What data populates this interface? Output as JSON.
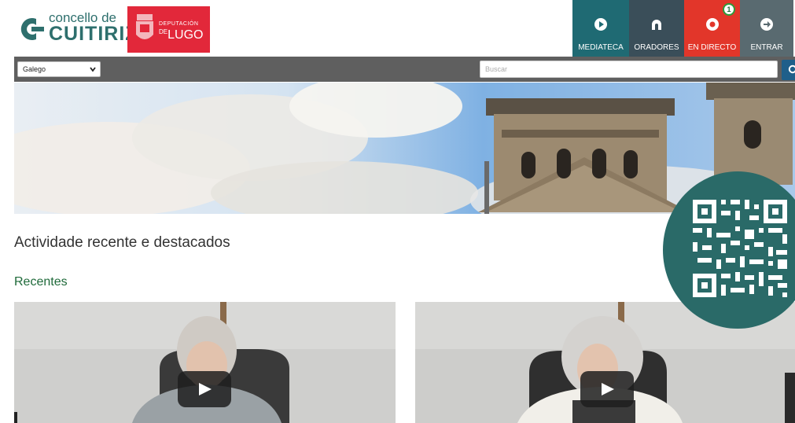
{
  "header": {
    "logo_line1": "concello de",
    "logo_line2": "CUITIRIZ",
    "partner_line1": "DEPUTACIÓN",
    "partner_de": "DE",
    "partner_line2": "LUGO"
  },
  "nav": [
    {
      "label": "MEDIATECA",
      "icon": "play-circle-icon",
      "color": "#1f6a73"
    },
    {
      "label": "ORADORES",
      "icon": "speaker-user-icon",
      "color": "#3a4e59"
    },
    {
      "label": "EN DIRECTO",
      "icon": "live-eye-icon",
      "color": "#e2362a",
      "badge": "1"
    },
    {
      "label": "ENTRAR",
      "icon": "arrow-right-circle-icon",
      "color": "#596a70"
    }
  ],
  "toolbar": {
    "language_value": "Galego",
    "search_placeholder": "Buscar"
  },
  "main": {
    "heading": "Actividade recente e destacados",
    "subheading": "Recentes"
  },
  "videos": [
    {
      "icon": "play-button-icon"
    },
    {
      "icon": "play-button-icon"
    }
  ]
}
